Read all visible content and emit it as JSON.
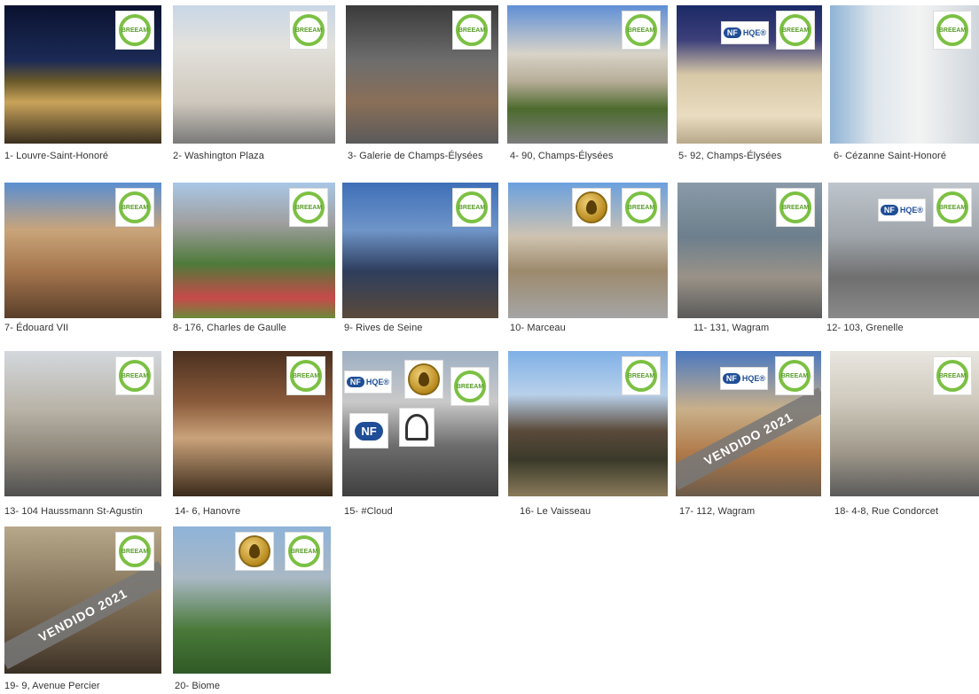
{
  "colors": {
    "breeam_green": "#7bc043",
    "nf_blue": "#1f4e96",
    "leed_gold": "#c9a23a",
    "ribbon_gray": "#787878",
    "caption_text": "#333333"
  },
  "ribbon_text": "VENDIDO 2021",
  "badges": {
    "breeam": "BREEAM",
    "nf": "NF",
    "hqe": "HQE®"
  },
  "properties": [
    {
      "caption": "1- Louvre-Saint-Honoré",
      "certs": [
        "breeam"
      ],
      "sold": false
    },
    {
      "caption": "2- Washington Plaza",
      "certs": [
        "breeam"
      ],
      "sold": false
    },
    {
      "caption": "3- Galerie de Champs-Élysées",
      "certs": [
        "breeam"
      ],
      "sold": false
    },
    {
      "caption": "4- 90, Champs-Élysées",
      "certs": [
        "breeam"
      ],
      "sold": false
    },
    {
      "caption": "5- 92, Champs-Élysées",
      "certs": [
        "nf-hqe",
        "breeam"
      ],
      "sold": false
    },
    {
      "caption": "6- Cézanne Saint-Honoré",
      "certs": [
        "breeam"
      ],
      "sold": false
    },
    {
      "caption": "7- Édouard VII",
      "certs": [
        "breeam"
      ],
      "sold": false
    },
    {
      "caption": "8- 176, Charles de Gaulle",
      "certs": [
        "breeam"
      ],
      "sold": false
    },
    {
      "caption": "9- Rives de Seine",
      "certs": [
        "breeam"
      ],
      "sold": false
    },
    {
      "caption": "10- Marceau",
      "certs": [
        "leed",
        "breeam"
      ],
      "sold": false
    },
    {
      "caption": "11- 131, Wagram",
      "certs": [
        "breeam"
      ],
      "sold": false
    },
    {
      "caption": "12- 103, Grenelle",
      "certs": [
        "nf-hqe",
        "breeam"
      ],
      "sold": false
    },
    {
      "caption": "13- 104 Haussmann St-Agustin",
      "certs": [
        "breeam"
      ],
      "sold": false
    },
    {
      "caption": "14- 6, Hanovre",
      "certs": [
        "breeam"
      ],
      "sold": false
    },
    {
      "caption": "15- #Cloud",
      "certs": [
        "nf-hqe",
        "leed",
        "breeam",
        "nf",
        "well"
      ],
      "sold": false
    },
    {
      "caption": "16- Le Vaisseau",
      "certs": [
        "breeam"
      ],
      "sold": false
    },
    {
      "caption": "17- 112, Wagram",
      "certs": [
        "nf-hqe",
        "breeam"
      ],
      "sold": true
    },
    {
      "caption": "18- 4-8, Rue Condorcet",
      "certs": [
        "breeam"
      ],
      "sold": false
    },
    {
      "caption": "19- 9, Avenue Percier",
      "certs": [
        "breeam"
      ],
      "sold": true
    },
    {
      "caption": "20- Biome",
      "certs": [
        "leed",
        "breeam"
      ],
      "sold": false
    }
  ]
}
